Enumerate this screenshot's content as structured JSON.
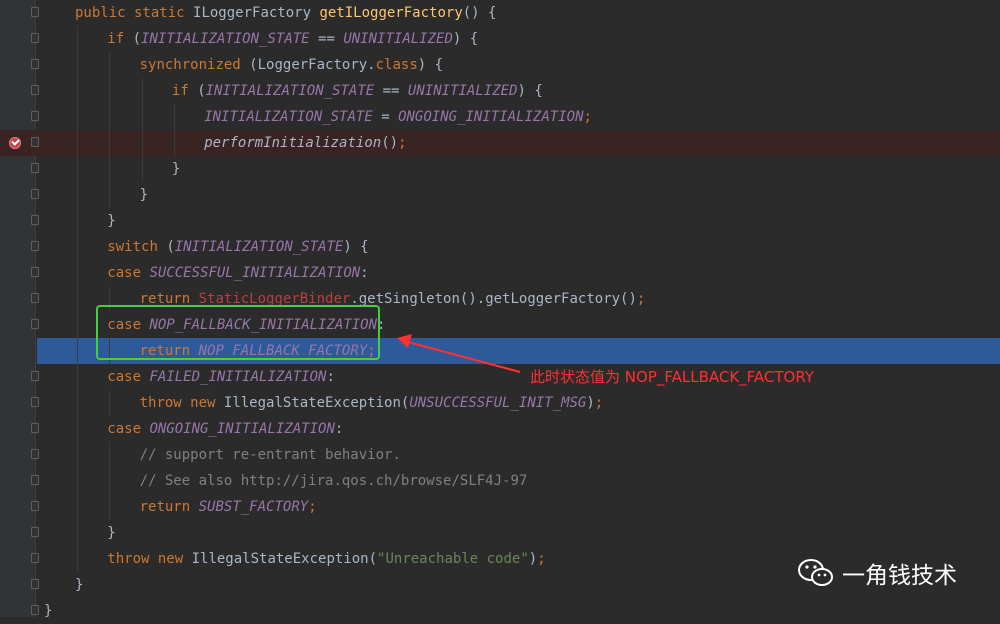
{
  "editor": {
    "lines": [
      [
        {
          "t": "public static ",
          "c": "k"
        },
        {
          "t": "ILoggerFactory ",
          "c": "c"
        },
        {
          "t": "getILoggerFactory",
          "c": "m"
        },
        {
          "t": "() {",
          "c": "c"
        }
      ],
      [
        {
          "t": "if ",
          "c": "k"
        },
        {
          "t": "(",
          "c": "c"
        },
        {
          "t": "INITIALIZATION_STATE",
          "c": "s"
        },
        {
          "t": " == ",
          "c": "c"
        },
        {
          "t": "UNINITIALIZED",
          "c": "s"
        },
        {
          "t": ") {",
          "c": "c"
        }
      ],
      [
        {
          "t": "synchronized ",
          "c": "k"
        },
        {
          "t": "(LoggerFactory.",
          "c": "c"
        },
        {
          "t": "class",
          "c": "k"
        },
        {
          "t": ") {",
          "c": "c"
        }
      ],
      [
        {
          "t": "if ",
          "c": "k"
        },
        {
          "t": "(",
          "c": "c"
        },
        {
          "t": "INITIALIZATION_STATE",
          "c": "s"
        },
        {
          "t": " == ",
          "c": "c"
        },
        {
          "t": "UNINITIALIZED",
          "c": "s"
        },
        {
          "t": ") {",
          "c": "c"
        }
      ],
      [
        {
          "t": "INITIALIZATION_STATE",
          "c": "s"
        },
        {
          "t": " = ",
          "c": "c"
        },
        {
          "t": "ONGOING_INITIALIZATION",
          "c": "s"
        },
        {
          "t": ";",
          "c": "k"
        }
      ],
      [
        {
          "t": "performInitialization",
          "c": "ic"
        },
        {
          "t": "()",
          "c": "c"
        },
        {
          "t": ";",
          "c": "k"
        }
      ],
      [
        {
          "t": "}",
          "c": "c"
        }
      ],
      [
        {
          "t": "}",
          "c": "c"
        }
      ],
      [
        {
          "t": "}",
          "c": "c"
        }
      ],
      [
        {
          "t": "switch ",
          "c": "k"
        },
        {
          "t": "(",
          "c": "c"
        },
        {
          "t": "INITIALIZATION_STATE",
          "c": "s"
        },
        {
          "t": ") {",
          "c": "c"
        }
      ],
      [
        {
          "t": "case ",
          "c": "k"
        },
        {
          "t": "SUCCESSFUL_INITIALIZATION",
          "c": "s"
        },
        {
          "t": ":",
          "c": "c"
        }
      ],
      [
        {
          "t": "return ",
          "c": "k"
        },
        {
          "t": "StaticLoggerBinder",
          "c": "err"
        },
        {
          "t": ".getSingleton().getLoggerFactory()",
          "c": "c"
        },
        {
          "t": ";",
          "c": "k"
        }
      ],
      [
        {
          "t": "case ",
          "c": "k"
        },
        {
          "t": "NOP_FALLBACK_INITIALIZATION",
          "c": "s"
        },
        {
          "t": ":",
          "c": "c"
        }
      ],
      [
        {
          "t": "return ",
          "c": "k"
        },
        {
          "t": "NOP_FALLBACK_FACTORY",
          "c": "s"
        },
        {
          "t": ";",
          "c": "k"
        }
      ],
      [
        {
          "t": "case ",
          "c": "k"
        },
        {
          "t": "FAILED_INITIALIZATION",
          "c": "s"
        },
        {
          "t": ":",
          "c": "c"
        }
      ],
      [
        {
          "t": "throw new ",
          "c": "k"
        },
        {
          "t": "IllegalStateException(",
          "c": "c"
        },
        {
          "t": "UNSUCCESSFUL_INIT_MSG",
          "c": "s"
        },
        {
          "t": ")",
          "c": "c"
        },
        {
          "t": ";",
          "c": "k"
        }
      ],
      [
        {
          "t": "case ",
          "c": "k"
        },
        {
          "t": "ONGOING_INITIALIZATION",
          "c": "s"
        },
        {
          "t": ":",
          "c": "c"
        }
      ],
      [
        {
          "t": "// support re-entrant behavior.",
          "c": "cm"
        }
      ],
      [
        {
          "t": "// See also http://jira.qos.ch/browse/SLF4J-97",
          "c": "cm"
        }
      ],
      [
        {
          "t": "return ",
          "c": "k"
        },
        {
          "t": "SUBST_FACTORY",
          "c": "s"
        },
        {
          "t": ";",
          "c": "k"
        }
      ],
      [
        {
          "t": "}",
          "c": "c"
        }
      ],
      [
        {
          "t": "throw new ",
          "c": "k"
        },
        {
          "t": "IllegalStateException(",
          "c": "c"
        },
        {
          "t": "\"Unreachable code\"",
          "c": "str"
        },
        {
          "t": ")",
          "c": "c"
        },
        {
          "t": ";",
          "c": "k"
        }
      ],
      [
        {
          "t": "}",
          "c": "c"
        }
      ],
      [
        {
          "t": "}",
          "c": "c"
        }
      ]
    ]
  },
  "annotation": {
    "text": "此时状态值为 NOP_FALLBACK_FACTORY",
    "color": "#ff3030"
  },
  "highlight_box_color": "#3fd13f",
  "watermark": {
    "icon": "wechat-icon",
    "text": "一角钱技术"
  },
  "colors": {
    "background": "#2b2b2b",
    "keyword": "#cc7832",
    "static_field": "#9876aa",
    "method": "#ffc66d",
    "string": "#6a8759",
    "comment": "#808080",
    "current_line": "#2d5a9b",
    "breakpoint_line": "#3a2323"
  }
}
